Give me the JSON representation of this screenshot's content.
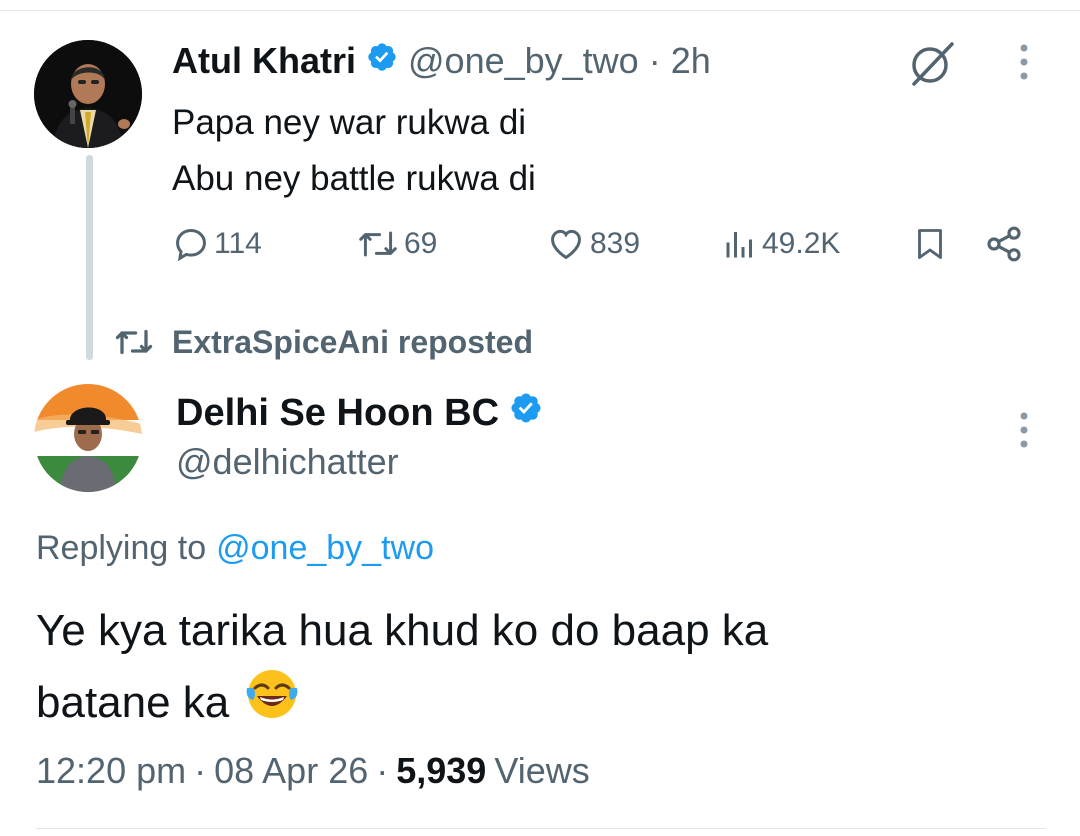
{
  "quoted_tweet": {
    "author_name": "Atul Khatri",
    "handle": "@one_by_two",
    "separator": "·",
    "time": "2h",
    "lines": [
      "Papa ney war rukwa di",
      "Abu ney battle rukwa di"
    ],
    "replies": "114",
    "reposts": "69",
    "likes": "839",
    "views": "49.2K"
  },
  "repost_banner": {
    "text": "ExtraSpiceAni reposted"
  },
  "tweet": {
    "author_name": "Delhi Se Hoon BC",
    "handle": "@delhichatter",
    "replying_prefix": "Replying to",
    "replying_handle": "@one_by_two",
    "lines": [
      "Ye kya tarika hua khud ko do baap ka",
      "batane ka"
    ],
    "emoji": "face-with-tears-of-joy",
    "time": "12:20 pm",
    "sep1": "·",
    "date": "08 Apr 26",
    "sep2": "·",
    "views_count": "5,939",
    "views_label": "Views"
  },
  "colors": {
    "verified": "#1d9bf0",
    "muted": "#536471",
    "link": "#1d9bf0",
    "text": "#0f1419"
  }
}
